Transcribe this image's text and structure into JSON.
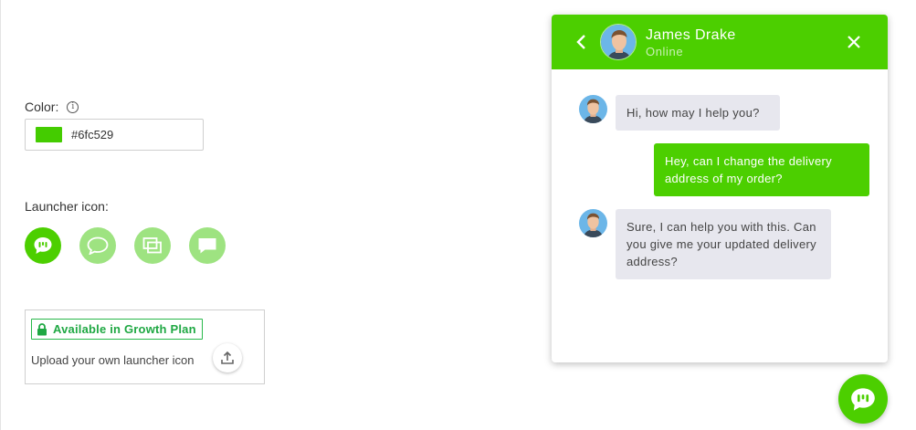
{
  "settings": {
    "color_label": "Color:",
    "color_value": "#6fc529",
    "launcher_label": "Launcher icon:",
    "launcher_icons": [
      {
        "name": "chat-bubble-bars-icon",
        "selected": true
      },
      {
        "name": "speech-bubble-icon",
        "selected": false
      },
      {
        "name": "stacked-windows-icon",
        "selected": false
      },
      {
        "name": "square-message-icon",
        "selected": false
      }
    ],
    "plan_badge": "Available in Growth Plan",
    "upload_text": "Upload your own launcher icon"
  },
  "chat": {
    "agent_name": "James Drake",
    "agent_status": "Online",
    "messages": [
      {
        "from": "agent",
        "text": "Hi, how may I help you?"
      },
      {
        "from": "user",
        "text": "Hey, can I change the delivery address of my order?"
      },
      {
        "from": "agent",
        "text": "Sure, I can help you with this. Can you give me your updated delivery address?"
      }
    ]
  },
  "colors": {
    "accent": "#4ccf00",
    "accent_light": "#9ee381",
    "swatch": "#44cc00",
    "badge_green": "#1fa843"
  },
  "icons": {
    "info": "info-icon",
    "lock": "lock-icon",
    "upload": "upload-icon",
    "back": "chevron-left-icon",
    "close": "close-icon",
    "launcher": "chat-bubble-bars-icon"
  }
}
